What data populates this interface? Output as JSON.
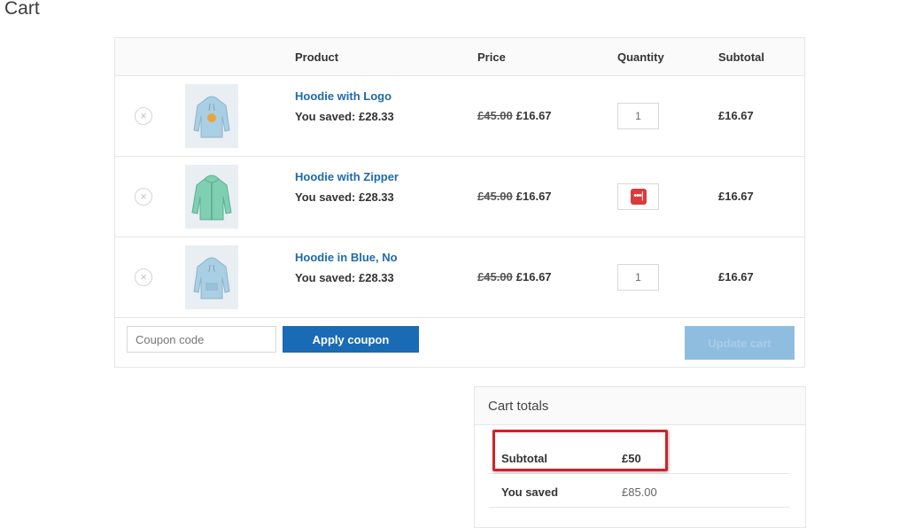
{
  "page": {
    "title": "Cart"
  },
  "cart": {
    "headers": {
      "product": "Product",
      "price": "Price",
      "quantity": "Quantity",
      "subtotal": "Subtotal"
    },
    "remove_symbol": "×",
    "items": [
      {
        "name": "Hoodie with Logo",
        "saved": "You saved: £28.33",
        "old_price": "£45.00",
        "price": "£16.67",
        "quantity": "1",
        "subtotal": "£16.67",
        "thumb_color": "#a9cfe4"
      },
      {
        "name": "Hoodie with Zipper",
        "saved": "You saved: £28.33",
        "old_price": "£45.00",
        "price": "£16.67",
        "quantity_icon": "•••|",
        "subtotal": "£16.67",
        "thumb_color": "#7fcfb3"
      },
      {
        "name": "Hoodie in Blue, No",
        "saved": "You saved: £28.33",
        "old_price": "£45.00",
        "price": "£16.67",
        "quantity": "1",
        "subtotal": "£16.67",
        "thumb_color": "#a9cfe4"
      }
    ],
    "coupon": {
      "placeholder": "Coupon code",
      "apply_label": "Apply coupon"
    },
    "update_label": "Update cart"
  },
  "totals": {
    "title": "Cart totals",
    "rows": [
      {
        "label": "Subtotal",
        "value": "£50"
      },
      {
        "label": "You saved",
        "value": "£85.00"
      }
    ]
  },
  "colors": {
    "accent": "#1a6bb5",
    "link": "#1f6aa8",
    "highlight": "#d0222a",
    "update_disabled": "#8fbde0"
  }
}
